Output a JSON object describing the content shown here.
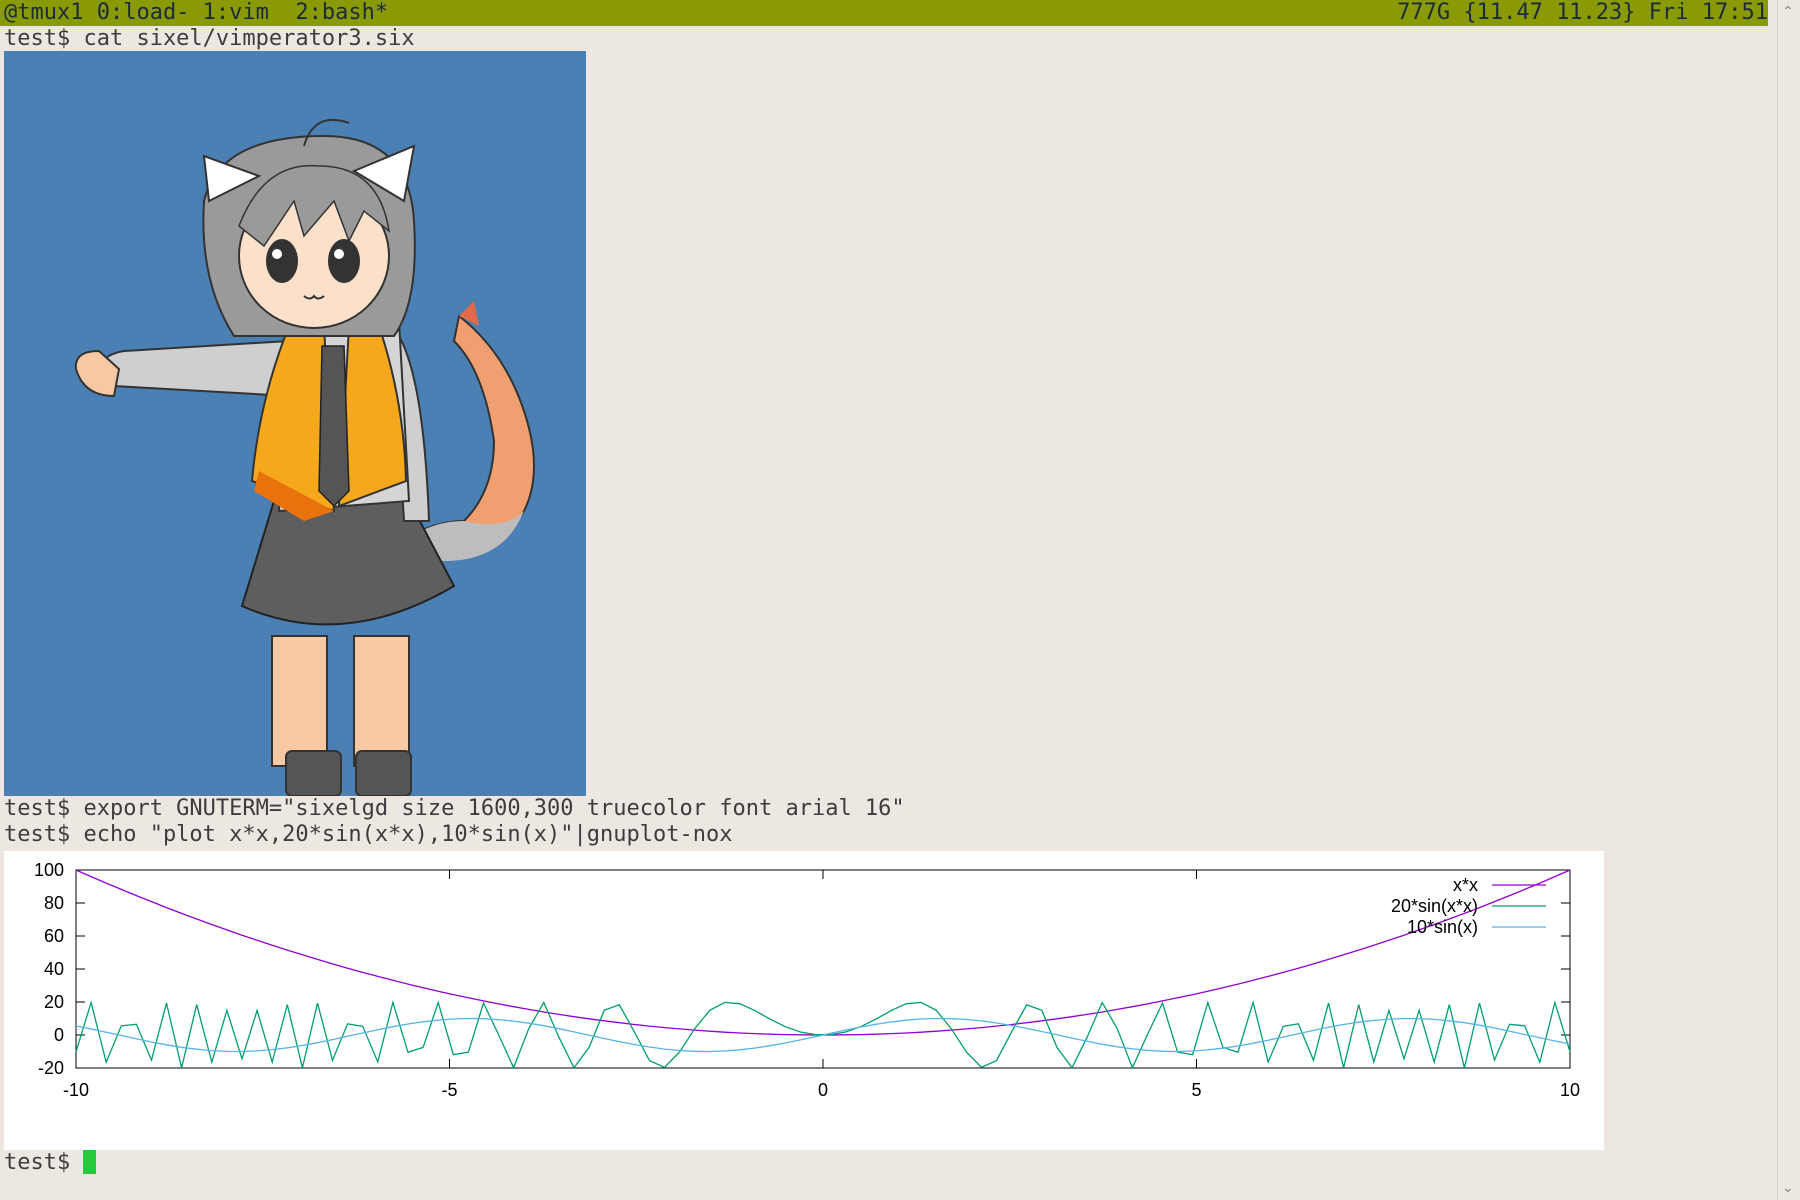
{
  "tmux": {
    "left": "@tmux1 0:load- 1:vim  2:bash*",
    "right": "777G {11.47 11.23} Fri 17:51"
  },
  "terminal": {
    "prompt": "test$",
    "cmd1": "test$ cat sixel/vimperator3.six",
    "cmd2": "test$ export GNUTERM=\"sixelgd size 1600,300 truecolor font arial 16\"",
    "cmd3": "test$ echo \"plot x*x,20*sin(x*x),10*sin(x)\"|gnuplot-nox"
  },
  "colors": {
    "status_bg": "#8a9a05",
    "image_bg": "#4a80b4",
    "cursor": "#27c93f",
    "series1": "#9400d3",
    "series2": "#009e73",
    "series3": "#56b4e9"
  },
  "chart_data": {
    "type": "line",
    "title": "",
    "xlabel": "",
    "ylabel": "",
    "xlim": [
      -10,
      10
    ],
    "ylim": [
      -20,
      100
    ],
    "xticks": [
      "-10",
      "-5",
      "0",
      "5",
      "10"
    ],
    "yticks": [
      "-20",
      "0",
      "20",
      "40",
      "60",
      "80",
      "100"
    ],
    "legend_position": "top-right",
    "samples": 100,
    "series": [
      {
        "name": "x*x",
        "expr": "x*x",
        "color": "#9400d3"
      },
      {
        "name": "20*sin(x*x)",
        "expr": "20*sin(x*x)",
        "color": "#009e73"
      },
      {
        "name": "10*sin(x)",
        "expr": "10*sin(x)",
        "color": "#56b4e9"
      }
    ]
  },
  "icons": {
    "scroll_up": "chevron-up-icon",
    "scroll_down": "chevron-down-icon"
  }
}
